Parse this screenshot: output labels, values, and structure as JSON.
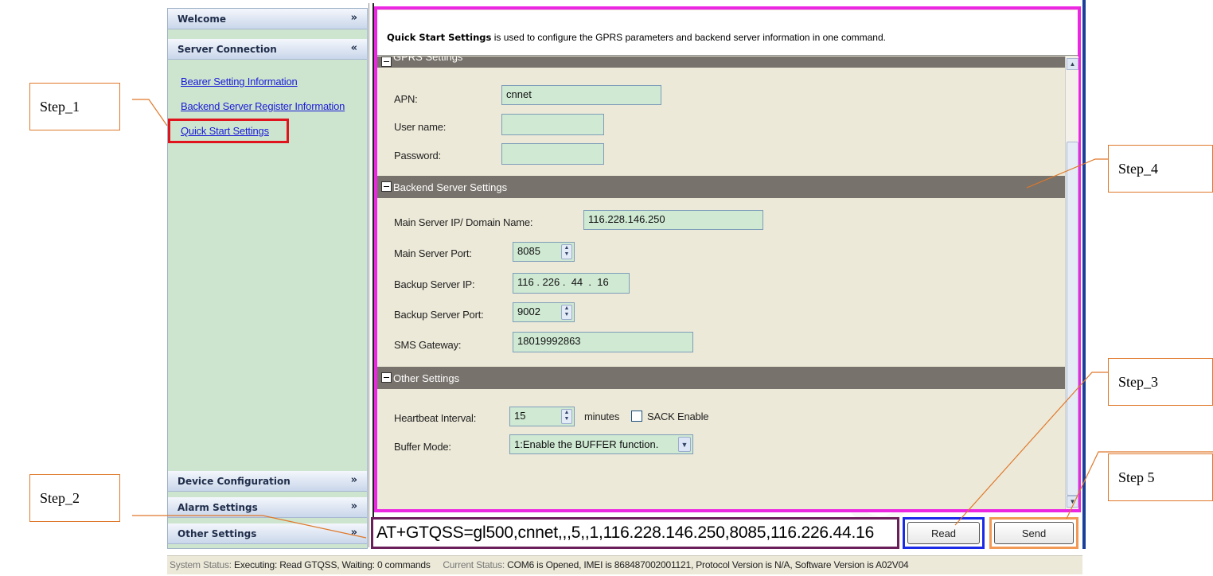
{
  "steps": {
    "step1": "Step_1",
    "step2": "Step_2",
    "step3": "Step_3",
    "step4": "Step_4",
    "step5": "Step  5"
  },
  "sidebar": {
    "welcome": "Welcome",
    "server_connection": "Server Connection",
    "links": [
      "Bearer Setting Information",
      "Backend Server Register Information",
      "Quick Start Settings"
    ],
    "device_configuration": "Device Configuration",
    "alarm_settings": "Alarm Settings",
    "other_settings": "Other Settings",
    "icons": {
      "collapse": "double-chevron-up-icon",
      "expand": "double-chevron-down-icon"
    }
  },
  "header": {
    "title": "Quick Start Settings",
    "description": "is used to configure the GPRS parameters and backend server information in one command."
  },
  "gprs": {
    "section_title": "GPRS Settings",
    "apn_label": "APN:",
    "apn_value": "cnnet",
    "username_label": "User name:",
    "username_value": "",
    "password_label": "Password:",
    "password_value": ""
  },
  "backend": {
    "section_title": "Backend Server Settings",
    "main_ip_label": "Main Server IP/ Domain Name:",
    "main_ip_value": "116.228.146.250",
    "main_port_label": "Main Server Port:",
    "main_port_value": "8085",
    "backup_ip_label": "Backup Server IP:",
    "backup_ip_value": "116 . 226 .  44  .  16",
    "backup_port_label": "Backup Server Port:",
    "backup_port_value": "9002",
    "sms_label": "SMS Gateway:",
    "sms_value": "18019992863"
  },
  "other": {
    "section_title": "Other Settings",
    "heartbeat_label": "Heartbeat Interval:",
    "heartbeat_value": "15",
    "minutes_label": "minutes",
    "sack_label": "SACK Enable",
    "sack_checked": false,
    "buffer_label": "Buffer Mode:",
    "buffer_value": "1:Enable the BUFFER function."
  },
  "command": {
    "text": "AT+GTQSS=gl500,cnnet,,,5,,1,116.228.146.250,8085,116.226.44.16",
    "read_label": "Read",
    "send_label": "Send"
  },
  "status": {
    "system_label": "System Status:",
    "system_value": "Executing: Read GTQSS, Waiting: 0 commands",
    "current_label": "Current Status:",
    "current_value": "COM6 is Opened, IMEI is 868487002001121, Protocol Version is N/A, Software Version is A02V04"
  },
  "colors": {
    "step_border": "#e0782a",
    "nav_bg": "#cde5cf",
    "selected_outline": "#e0141c",
    "panel_outline": "#ec27e2",
    "command_outline": "#6b1f5a",
    "read_outline": "#1a2ae6",
    "send_outline": "#f29a55",
    "section_bar": "#77726b",
    "field_bg": "#cfe9d3"
  }
}
